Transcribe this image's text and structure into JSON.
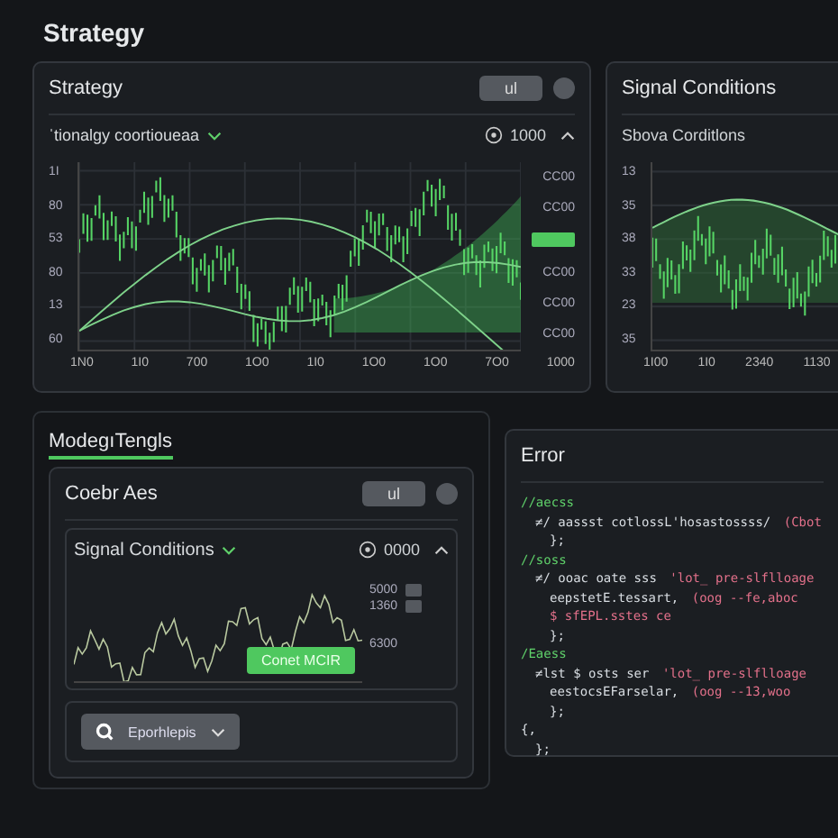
{
  "page_title": "Strategy",
  "strategy_card": {
    "title": "Strategy",
    "toggle_label": "ul",
    "dropdown": "ˈtionalgy coortioueaa",
    "reading": "1000",
    "y_labels": [
      "1I",
      "80",
      "53",
      "80",
      "13",
      "60"
    ],
    "right_labels": [
      "CC00",
      "CC00",
      "CC00",
      "CC00",
      "CC00"
    ],
    "x_labels": [
      "1N0",
      "1I0",
      "700",
      "1O0",
      "1I0",
      "1O0",
      "1O0",
      "7O0",
      "1000"
    ]
  },
  "signal_card": {
    "title": "Signal Conditions",
    "subtitle": "Sbova Corditlons",
    "y_labels": [
      "13",
      "35",
      "38",
      "33",
      "23",
      "35"
    ],
    "x_labels": [
      "1I00",
      "1I0",
      "2340",
      "1130"
    ]
  },
  "bottom_tab": {
    "label": "ModegıTengls",
    "selected": true
  },
  "settings_card": {
    "title": "Coebr Aes",
    "toggle_label": "ul",
    "dropdown": "Signal Conditions",
    "reading": "0000",
    "right_labels": [
      "5000",
      "1360",
      "6300"
    ],
    "action": "Conet MCIR",
    "menu_button": "Eporhlepis"
  },
  "error_card": {
    "title": "Error",
    "lines": [
      {
        "code": "//aecss",
        "kind": "comment",
        "children": [
          {
            "code": "≠/ aassst cotlossL'hosastossss/",
            "str": "(Cbot",
            "kind": "code",
            "children": [
              {
                "code": "};",
                "kind": "code"
              }
            ]
          }
        ]
      },
      {
        "code": "//soss",
        "kind": "comment",
        "children": [
          {
            "code": "≠/ ooac oate sss",
            "str": "'lot_ pre-slflloage",
            "kind": "code",
            "children": [
              {
                "code": "eepstetE.tessart,",
                "str": "(oog --fe,aboc",
                "kind": "code"
              },
              {
                "code": "$ sfEPL.sstes ce",
                "kind": "string"
              },
              {
                "code": "};",
                "kind": "code"
              }
            ]
          }
        ]
      },
      {
        "code": "/Eaess",
        "kind": "comment",
        "children": [
          {
            "code": "≠lst $ osts ser",
            "str": "'lot_ pre-slflloage",
            "kind": "code",
            "children": [
              {
                "code": "eestocsEFarselar,",
                "str": "(oog --13,woo",
                "kind": "code"
              },
              {
                "code": "};",
                "kind": "code"
              }
            ]
          }
        ]
      },
      {
        "code": "{,",
        "kind": "code",
        "children": [
          {
            "code": "};",
            "kind": "code"
          }
        ]
      }
    ]
  }
}
